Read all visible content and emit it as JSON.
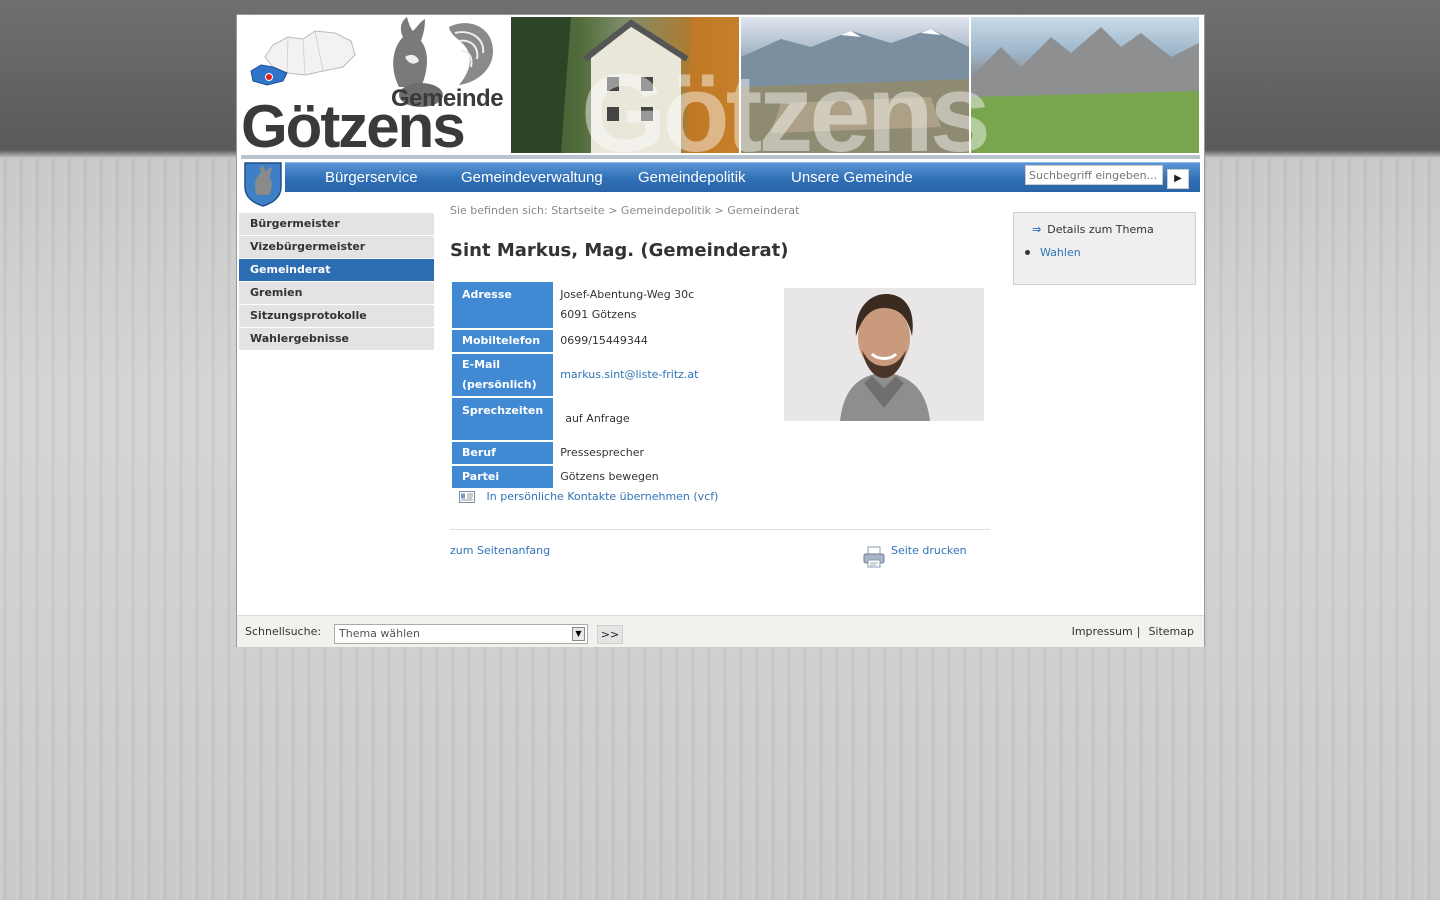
{
  "header": {
    "logo_small": "Gemeinde",
    "logo_big": "Götzens",
    "watermark": "Götzens"
  },
  "nav": {
    "items": [
      "Bürgerservice",
      "Gemeindeverwaltung",
      "Gemeindepolitik",
      "Unsere Gemeinde"
    ],
    "search_placeholder": "Suchbegriff eingeben...",
    "search_button": "▶"
  },
  "sidebar": {
    "items": [
      "Bürgermeister",
      "Vizebürgermeister",
      "Gemeinderat",
      "Gremien",
      "Sitzungsprotokolle",
      "Wahlergebnisse"
    ],
    "active_index": 2
  },
  "breadcrumb": {
    "prefix": "Sie befinden sich:",
    "items": [
      "Startseite",
      "Gemeindepolitik",
      "Gemeinderat"
    ],
    "separator": ">"
  },
  "person": {
    "title": "Sint Markus, Mag. (Gemeinderat)",
    "labels": {
      "address": "Adresse",
      "mobile": "Mobiltelefon",
      "email_line1": "E-Mail",
      "email_line2": "(persönlich)",
      "hours": "Sprechzeiten",
      "job": "Beruf",
      "party": "Partei"
    },
    "address_line1": "Josef-Abentung-Weg 30c",
    "address_line2": "6091 Götzens",
    "mobile": "0699/15449344",
    "email": "markus.sint@liste-fritz.at",
    "hours": "auf Anfrage",
    "job": "Pressesprecher",
    "party": "Götzens bewegen"
  },
  "actions": {
    "vcf": "In persönliche Kontakte übernehmen (vcf)",
    "to_top": "zum Seitenanfang",
    "print": "Seite drucken"
  },
  "rightbox": {
    "title": "Details zum Thema",
    "link": "Wahlen"
  },
  "footer": {
    "quicksearch_label": "Schnellsuche:",
    "select_value": "Thema wählen",
    "go_label": ">>",
    "impressum": "Impressum",
    "sep": "|",
    "sitemap": "Sitemap"
  },
  "colors": {
    "accent_blue": "#4189d3",
    "nav_blue": "#2f6fb5",
    "link_blue": "#2f74b8"
  }
}
